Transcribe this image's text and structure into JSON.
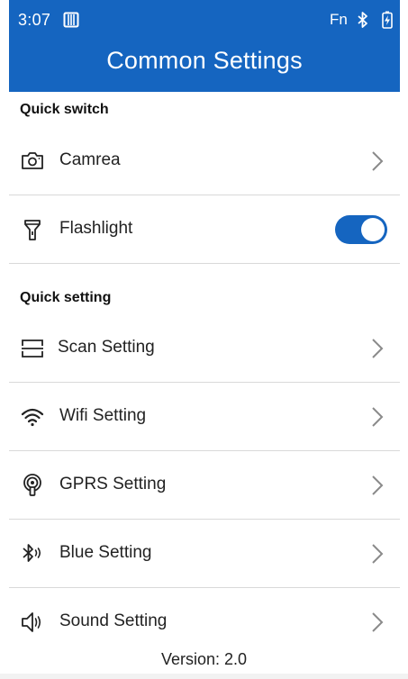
{
  "status_bar": {
    "time": "3:07",
    "fn_label": "Fn"
  },
  "header": {
    "title": "Common Settings"
  },
  "sections": {
    "quick_switch": {
      "title": "Quick switch",
      "items": [
        {
          "label": "Camrea",
          "icon": "camera-icon",
          "control": "chevron"
        },
        {
          "label": "Flashlight",
          "icon": "flashlight-icon",
          "control": "toggle",
          "toggle_on": true
        }
      ]
    },
    "quick_setting": {
      "title": "Quick setting",
      "items": [
        {
          "label": "Scan Setting",
          "icon": "scan-icon",
          "control": "chevron"
        },
        {
          "label": "Wifi Setting",
          "icon": "wifi-icon",
          "control": "chevron"
        },
        {
          "label": "GPRS Setting",
          "icon": "gprs-icon",
          "control": "chevron"
        },
        {
          "label": "Blue Setting",
          "icon": "bluetooth-icon",
          "control": "chevron"
        },
        {
          "label": "Sound Setting",
          "icon": "sound-icon",
          "control": "chevron"
        }
      ]
    }
  },
  "footer": {
    "version": "Version: 2.0"
  },
  "colors": {
    "primary": "#1565c0",
    "divider": "#d9d9d9",
    "chevron": "#8a8a8a",
    "text": "#222222",
    "background": "#ffffff"
  }
}
